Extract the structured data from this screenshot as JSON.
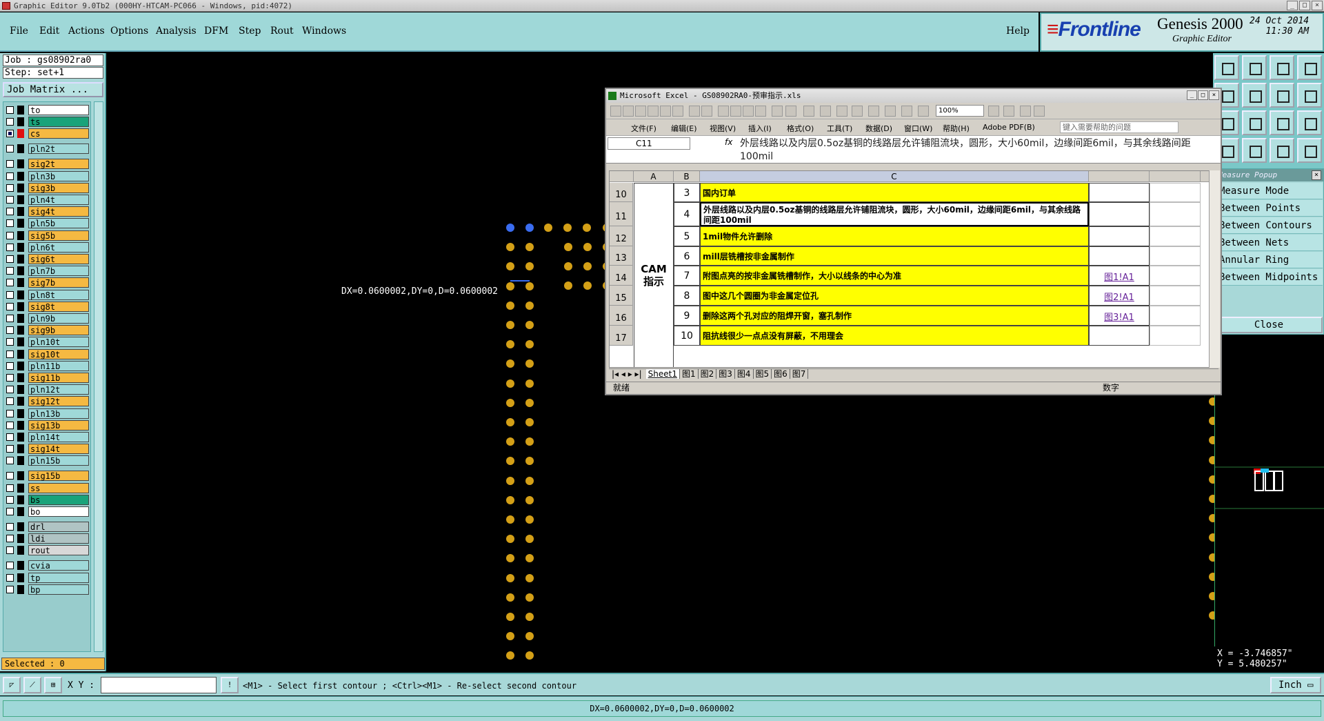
{
  "window": {
    "title": "Graphic Editor 9.0Tb2 (000HY-HTCAM-PC066 - Windows, pid:4072)"
  },
  "menu": {
    "items": [
      "File",
      "Edit",
      "Actions",
      "Options",
      "Analysis",
      "DFM",
      "Step",
      "Rout",
      "Windows"
    ],
    "help": "Help"
  },
  "brand": {
    "logo": "Frontline",
    "product": "Genesis 2000",
    "module": "Graphic Editor",
    "date": "24 Oct 2014",
    "time": "11:30 AM"
  },
  "left": {
    "job": "Job : gs08902ra0",
    "step": "Step: set+1",
    "job_matrix": "Job Matrix ...",
    "layers": [
      {
        "name": "to",
        "color": "#ffffff"
      },
      {
        "name": "ts",
        "color": "#1aa37a"
      },
      {
        "name": "cs",
        "color": "#f5b942"
      },
      {
        "name": "pln2t",
        "color": "#9fd8d8"
      },
      {
        "name": "sig2t",
        "color": "#f5b942"
      },
      {
        "name": "pln3b",
        "color": "#9fd8d8"
      },
      {
        "name": "sig3b",
        "color": "#f5b942"
      },
      {
        "name": "pln4t",
        "color": "#9fd8d8"
      },
      {
        "name": "sig4t",
        "color": "#f5b942"
      },
      {
        "name": "pln5b",
        "color": "#9fd8d8"
      },
      {
        "name": "sig5b",
        "color": "#f5b942"
      },
      {
        "name": "pln6t",
        "color": "#9fd8d8"
      },
      {
        "name": "sig6t",
        "color": "#f5b942"
      },
      {
        "name": "pln7b",
        "color": "#9fd8d8"
      },
      {
        "name": "sig7b",
        "color": "#f5b942"
      },
      {
        "name": "pln8t",
        "color": "#9fd8d8"
      },
      {
        "name": "sig8t",
        "color": "#f5b942"
      },
      {
        "name": "pln9b",
        "color": "#9fd8d8"
      },
      {
        "name": "sig9b",
        "color": "#f5b942"
      },
      {
        "name": "pln10t",
        "color": "#9fd8d8"
      },
      {
        "name": "sig10t",
        "color": "#f5b942"
      },
      {
        "name": "pln11b",
        "color": "#9fd8d8"
      },
      {
        "name": "sig11b",
        "color": "#f5b942"
      },
      {
        "name": "pln12t",
        "color": "#9fd8d8"
      },
      {
        "name": "sig12t",
        "color": "#f5b942"
      },
      {
        "name": "pln13b",
        "color": "#9fd8d8"
      },
      {
        "name": "sig13b",
        "color": "#f5b942"
      },
      {
        "name": "pln14t",
        "color": "#9fd8d8"
      },
      {
        "name": "sig14t",
        "color": "#f5b942"
      },
      {
        "name": "pln15b",
        "color": "#9fd8d8"
      },
      {
        "name": "sig15b",
        "color": "#f5b942"
      },
      {
        "name": "ss",
        "color": "#f5b942"
      },
      {
        "name": "bs",
        "color": "#1aa37a"
      },
      {
        "name": "bo",
        "color": "#ffffff"
      },
      {
        "name": "drl",
        "color": "#b0c4c4"
      },
      {
        "name": "ldi",
        "color": "#b0c4c4"
      },
      {
        "name": "rout",
        "color": "#d8d8d8"
      },
      {
        "name": "cvia",
        "color": "#9fd8d8"
      },
      {
        "name": "tp",
        "color": "#9fd8d8"
      },
      {
        "name": "bp",
        "color": "#9fd8d8"
      }
    ],
    "selected": "Selected : 0"
  },
  "canvas": {
    "measure_text": "DX=0.0600002,DY=0,D=0.0600002",
    "pad_color": "#d4a017",
    "selection_color": "#3a6cf0"
  },
  "popup": {
    "title": "Measure Popup",
    "items": [
      "Measure Mode",
      "Between Points",
      "Between Contours",
      "Between Nets",
      "Annular Ring",
      "Between Midpoints"
    ],
    "close": "Close"
  },
  "coords": {
    "x": "X = -3.746857\"",
    "y": "Y = 5.480257\""
  },
  "command": {
    "xy_label": "X Y :",
    "xy_value": "",
    "hint": "<M1> - Select first contour ; <Ctrl><M1> - Re-select second contour",
    "units": "Inch"
  },
  "status": {
    "text": "DX=0.0600002,DY=0,D=0.0600002"
  },
  "excel": {
    "title": "Microsoft Excel - GS08902RA0-预审指示.xls",
    "zoom": "100%",
    "menus": [
      "文件(F)",
      "编辑(E)",
      "视图(V)",
      "插入(I)",
      "格式(O)",
      "工具(T)",
      "数据(D)",
      "窗口(W)",
      "帮助(H)",
      "Adobe PDF(B)"
    ],
    "help_placeholder": "键入需要帮助的问题",
    "name_box": "C11",
    "fx": "fx",
    "formula": "外层线路以及内层0.5oz基铜的线路层允许铺阻流块，圆形，大小60mil，边缘间距6mil，与其余线路间距100mil",
    "columns": [
      "A",
      "B",
      "C"
    ],
    "merged_a": "CAM\n指示",
    "rows": [
      {
        "row": "10",
        "num": "3",
        "text": "国内订单",
        "link": ""
      },
      {
        "row": "11",
        "num": "4",
        "text": "外层线路以及内层0.5oz基铜的线路层允许铺阻流块，圆形，大小60mil，边缘间距6mil，与其余线路间距100mil",
        "link": ""
      },
      {
        "row": "12",
        "num": "5",
        "text": "1mil物件允许删除",
        "link": ""
      },
      {
        "row": "13",
        "num": "6",
        "text": "mill层铣槽按非金属制作",
        "link": ""
      },
      {
        "row": "14",
        "num": "7",
        "text": "附图点亮的按非金属铣槽制作，大小以线条的中心为准",
        "link": "图1!A1"
      },
      {
        "row": "15",
        "num": "8",
        "text": "图中这几个圆圈为非金属定位孔",
        "link": "图2!A1"
      },
      {
        "row": "16",
        "num": "9",
        "text": "删除这两个孔对应的阻焊开窗，塞孔制作",
        "link": "图3!A1"
      },
      {
        "row": "17",
        "num": "10",
        "text": "阻抗线很少一点点没有屏蔽，不用理会",
        "link": ""
      }
    ],
    "sheets": [
      "Sheet1",
      "图1",
      "图2",
      "图3",
      "图4",
      "图5",
      "图6",
      "图7"
    ],
    "status_left": "就绪",
    "status_right": "数字"
  }
}
